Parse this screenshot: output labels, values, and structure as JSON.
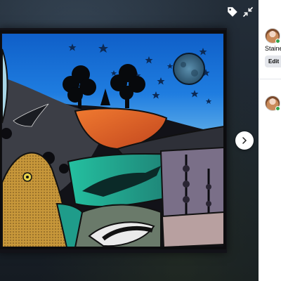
{
  "viewer": {
    "icons": {
      "tag": "tag-icon",
      "exit_fullscreen": "exit-fullscreen-icon",
      "next": "chevron-right-icon"
    },
    "colors": {
      "sky": "#1f74d8",
      "moon": "#3a6a8a",
      "orange_field": "#e0622a",
      "teal_glass": "#36b39c",
      "gold_hare": "#c89a3a"
    }
  },
  "sidebar": {
    "post_title": "Stainec",
    "edit_label": "Edit"
  }
}
